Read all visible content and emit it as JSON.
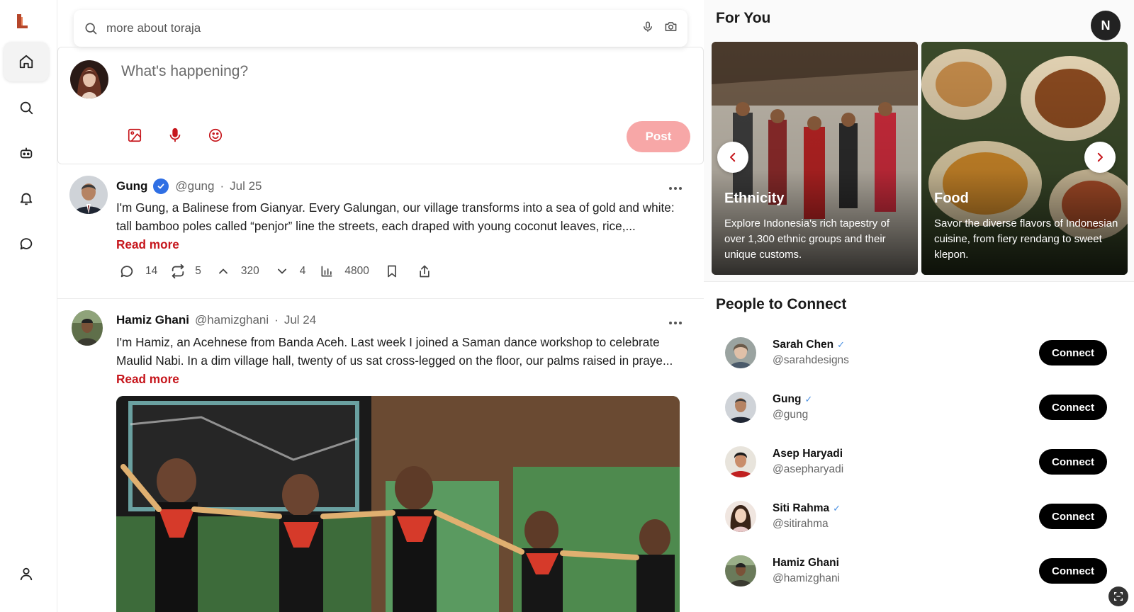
{
  "nav": {
    "items": [
      {
        "name": "home",
        "active": true
      },
      {
        "name": "search"
      },
      {
        "name": "bot"
      },
      {
        "name": "notifications"
      },
      {
        "name": "messages"
      }
    ],
    "profile": "profile"
  },
  "search": {
    "query": "more about toraja"
  },
  "composer": {
    "placeholder": "What's happening?",
    "post_label": "Post"
  },
  "feed": [
    {
      "name": "Gung",
      "verified": true,
      "handle": "@gung",
      "separator": "·",
      "date": "Jul 25",
      "text": "I'm Gung, a Balinese from Gianyar. Every Galungan, our village transforms into a sea of gold and white: tall bamboo poles called “penjor” line the streets, each draped with young coconut leaves, rice,...",
      "read_more": "Read more",
      "stats": {
        "replies": "14",
        "reposts": "5",
        "upvotes": "320",
        "downvotes": "4",
        "views": "4800"
      }
    },
    {
      "name": "Hamiz Ghani",
      "verified": false,
      "handle": "@hamizghani",
      "separator": "·",
      "date": "Jul 24",
      "text": "I'm Hamiz, an Acehnese from Banda Aceh. Last week I joined a Saman dance workshop to celebrate Maulid Nabi. In a dim village hall, twenty of us sat cross-legged on the floor, our palms raised in praye...",
      "read_more": "Read more"
    }
  ],
  "for_you": {
    "title": "For You",
    "user_initial": "N",
    "cards": [
      {
        "title": "Ethnicity",
        "description": "Explore Indonesia's rich tapestry of over 1,300 ethnic groups and their unique customs."
      },
      {
        "title": "Food",
        "description": "Savor the diverse flavors of Indonesian cuisine, from fiery rendang to sweet klepon."
      }
    ]
  },
  "people": {
    "title": "People to Connect",
    "connect_label": "Connect",
    "verified_mark": "✓",
    "list": [
      {
        "name": "Sarah Chen",
        "handle": "@sarahdesigns",
        "verified": true
      },
      {
        "name": "Gung",
        "handle": "@gung",
        "verified": true
      },
      {
        "name": "Asep Haryadi",
        "handle": "@asepharyadi",
        "verified": false
      },
      {
        "name": "Siti Rahma",
        "handle": "@sitirahma",
        "verified": true
      },
      {
        "name": "Hamiz Ghani",
        "handle": "@hamizghani",
        "verified": false
      }
    ]
  },
  "colors": {
    "accent": "#c6161c",
    "post_button": "#f7a7a7",
    "verified_blue": "#2f6fe4"
  }
}
